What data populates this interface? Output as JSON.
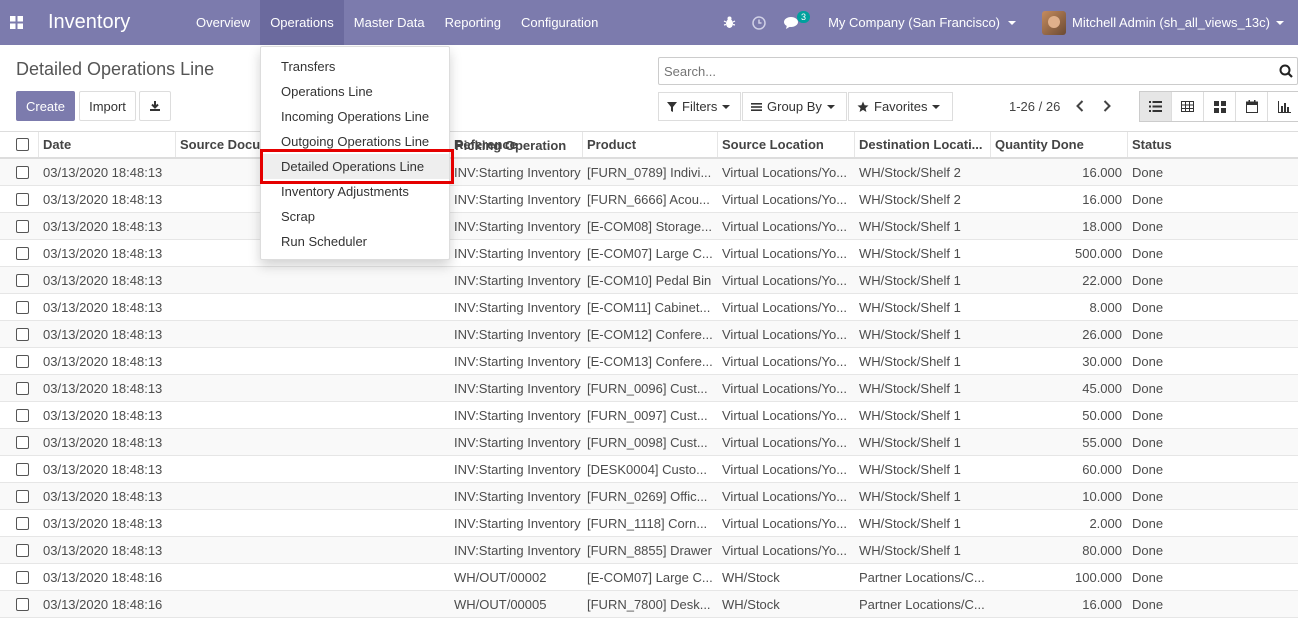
{
  "navbar": {
    "brand": "Inventory",
    "menu": [
      "Overview",
      "Operations",
      "Master Data",
      "Reporting",
      "Configuration"
    ],
    "active_menu": "Operations",
    "messages_badge": "3",
    "company": "My Company (San Francisco)",
    "user": "Mitchell Admin (sh_all_views_13c)",
    "color": "#7c7bad"
  },
  "control_panel": {
    "title": "Detailed Operations Line",
    "create_label": "Create",
    "import_label": "Import",
    "search_placeholder": "Search...",
    "filters_label": "Filters",
    "group_by_label": "Group By",
    "favorites_label": "Favorites",
    "pager": "1-26 / 26"
  },
  "dropdown": {
    "items": [
      "Transfers",
      "Operations Line",
      "Incoming Operations Line",
      "Outgoing Operations Line",
      "Detailed Operations Line",
      "Inventory Adjustments",
      "Scrap",
      "Run Scheduler"
    ],
    "selected": "Detailed Operations Line"
  },
  "table": {
    "headers": [
      "Date",
      "Source Docu",
      "Picking Operation",
      "Reference",
      "Product",
      "Source Location",
      "Destination Locati...",
      "Quantity Done",
      "Status"
    ],
    "rows": [
      [
        "03/13/2020 18:48:13",
        "",
        "INV:Starting Inventory",
        "[FURN_0789] Indivi...",
        "Virtual Locations/Yo...",
        "WH/Stock/Shelf 2",
        "16.000",
        "Done"
      ],
      [
        "03/13/2020 18:48:13",
        "",
        "INV:Starting Inventory",
        "[FURN_6666] Acou...",
        "Virtual Locations/Yo...",
        "WH/Stock/Shelf 2",
        "16.000",
        "Done"
      ],
      [
        "03/13/2020 18:48:13",
        "",
        "INV:Starting Inventory",
        "[E-COM08] Storage...",
        "Virtual Locations/Yo...",
        "WH/Stock/Shelf 1",
        "18.000",
        "Done"
      ],
      [
        "03/13/2020 18:48:13",
        "",
        "INV:Starting Inventory",
        "[E-COM07] Large C...",
        "Virtual Locations/Yo...",
        "WH/Stock/Shelf 1",
        "500.000",
        "Done"
      ],
      [
        "03/13/2020 18:48:13",
        "",
        "INV:Starting Inventory",
        "[E-COM10] Pedal Bin",
        "Virtual Locations/Yo...",
        "WH/Stock/Shelf 1",
        "22.000",
        "Done"
      ],
      [
        "03/13/2020 18:48:13",
        "",
        "INV:Starting Inventory",
        "[E-COM11] Cabinet...",
        "Virtual Locations/Yo...",
        "WH/Stock/Shelf 1",
        "8.000",
        "Done"
      ],
      [
        "03/13/2020 18:48:13",
        "",
        "INV:Starting Inventory",
        "[E-COM12] Confere...",
        "Virtual Locations/Yo...",
        "WH/Stock/Shelf 1",
        "26.000",
        "Done"
      ],
      [
        "03/13/2020 18:48:13",
        "",
        "INV:Starting Inventory",
        "[E-COM13] Confere...",
        "Virtual Locations/Yo...",
        "WH/Stock/Shelf 1",
        "30.000",
        "Done"
      ],
      [
        "03/13/2020 18:48:13",
        "",
        "INV:Starting Inventory",
        "[FURN_0096] Cust...",
        "Virtual Locations/Yo...",
        "WH/Stock/Shelf 1",
        "45.000",
        "Done"
      ],
      [
        "03/13/2020 18:48:13",
        "",
        "INV:Starting Inventory",
        "[FURN_0097] Cust...",
        "Virtual Locations/Yo...",
        "WH/Stock/Shelf 1",
        "50.000",
        "Done"
      ],
      [
        "03/13/2020 18:48:13",
        "",
        "INV:Starting Inventory",
        "[FURN_0098] Cust...",
        "Virtual Locations/Yo...",
        "WH/Stock/Shelf 1",
        "55.000",
        "Done"
      ],
      [
        "03/13/2020 18:48:13",
        "",
        "INV:Starting Inventory",
        "[DESK0004] Custo...",
        "Virtual Locations/Yo...",
        "WH/Stock/Shelf 1",
        "60.000",
        "Done"
      ],
      [
        "03/13/2020 18:48:13",
        "",
        "INV:Starting Inventory",
        "[FURN_0269] Offic...",
        "Virtual Locations/Yo...",
        "WH/Stock/Shelf 1",
        "10.000",
        "Done"
      ],
      [
        "03/13/2020 18:48:13",
        "",
        "INV:Starting Inventory",
        "[FURN_1118] Corn...",
        "Virtual Locations/Yo...",
        "WH/Stock/Shelf 1",
        "2.000",
        "Done"
      ],
      [
        "03/13/2020 18:48:13",
        "",
        "INV:Starting Inventory",
        "[FURN_8855] Drawer",
        "Virtual Locations/Yo...",
        "WH/Stock/Shelf 1",
        "80.000",
        "Done"
      ],
      [
        "03/13/2020 18:48:16",
        "",
        "WH/OUT/00002",
        "[E-COM07] Large C...",
        "WH/Stock",
        "Partner Locations/C...",
        "100.000",
        "Done"
      ],
      [
        "03/13/2020 18:48:16",
        "",
        "WH/OUT/00005",
        "[FURN_7800] Desk...",
        "WH/Stock",
        "Partner Locations/C...",
        "16.000",
        "Done"
      ]
    ]
  }
}
